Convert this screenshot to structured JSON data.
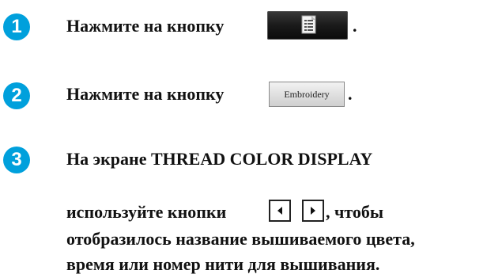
{
  "steps": [
    {
      "number": "1",
      "before": "Нажмите на кнопку",
      "after": "."
    },
    {
      "number": "2",
      "before": "Нажмите на кнопку",
      "button_label": "Embroidery",
      "after": "."
    },
    {
      "number": "3",
      "line1": "На экране THREAD COLOR DISPLAY",
      "line2_before": "используйте кнопки",
      "line2_after": ", чтобы",
      "line3": "отобразилось название вышиваемого цвета,",
      "line4": "время или номер нити для вышивания."
    }
  ],
  "colors": {
    "badge": "#00a0dc"
  },
  "icons": {
    "step1_button": "thread-list-icon",
    "left": "arrow-left-icon",
    "right": "arrow-right-icon"
  }
}
